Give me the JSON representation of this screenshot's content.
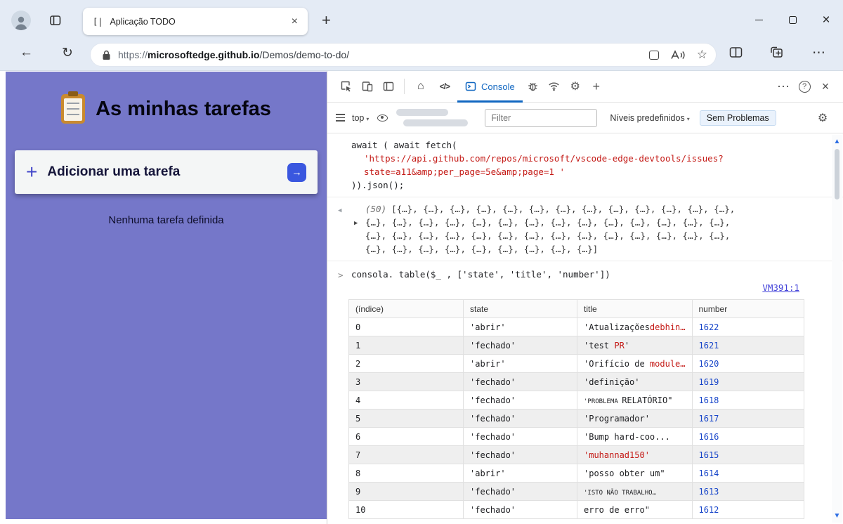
{
  "window": {
    "tab_title": "Aplicação TODO",
    "favicon_glyph": "[|",
    "url_scheme": "https://",
    "url_domain": "microsoftedge.github.io",
    "url_path": "/Demos/demo-to-do/"
  },
  "todo": {
    "title": "As minhas tarefas",
    "add_task": "Adicionar uma tarefa",
    "empty": "Nenhuma tarefa definida"
  },
  "devtools": {
    "console_tab": "Console",
    "context_label": "top",
    "filter_placeholder": "Filter",
    "levels_label": "Níveis predefinidos",
    "issues_label": "Sem Problemas",
    "cmd1_line1": "await ( await fetch(",
    "cmd1_line2": "'https://api.github.com/repos/microsoft/vscode-edge-devtools/issues?",
    "cmd1_line3": "state=a11&amp;per_page=5e&amp;page=1 '",
    "cmd1_line4": ")).json();",
    "result_count": "(50)",
    "result_line1": "[{…}, {…}, {…}, {…}, {…}, {…}, {…}, {…}, {…}, {…}, {…}, {…}, {…},",
    "result_line2": "{…}, {…}, {…}, {…}, {…}, {…}, {…}, {…}, {…}, {…}, {…}, {…}, {…}, {…},",
    "result_line3": "{…}, {…}, {…}, {…}, {…}, {…}, {…}, {…}, {…}, {…}, {…}, {…}, {…}, {…},",
    "result_line4": "{…}, {…}, {…}, {…}, {…}, {…}, {…}, {…}, {…}]",
    "cmd2": "consola. table($_  , ['state', 'title', 'number'])",
    "source_link": "VM391:1"
  },
  "table": {
    "headers": [
      "(índice)",
      "state",
      "title",
      "number"
    ],
    "rows": [
      {
        "index": "0",
        "state": "'abrir'",
        "title": [
          {
            "text": "'Atualizações",
            "style": "plain"
          },
          {
            "text": "debhin…",
            "style": "red"
          }
        ],
        "number": "1622"
      },
      {
        "index": "1",
        "state": "'fechado'",
        "title": [
          {
            "text": "'test   ",
            "style": "plain"
          },
          {
            "text": "PR",
            "style": "red"
          },
          {
            "text": "'",
            "style": "plain"
          }
        ],
        "number": "1621"
      },
      {
        "index": "2",
        "state": "'abrir'",
        "title": [
          {
            "text": "'Orifício de ",
            "style": "plain"
          },
          {
            "text": "module…",
            "style": "red"
          }
        ],
        "number": "1620"
      },
      {
        "index": "3",
        "state": "'fechado'",
        "title": [
          {
            "text": "'definição'",
            "style": "plain"
          }
        ],
        "number": "1619"
      },
      {
        "index": "4",
        "state": "'fechado'",
        "title": [
          {
            "text": "'PROBLEMA ",
            "style": "small"
          },
          {
            "text": "RELATÓRIO\"",
            "style": "plain"
          }
        ],
        "number": "1618"
      },
      {
        "index": "5",
        "state": "'fechado'",
        "title": [
          {
            "text": "'Programador'",
            "style": "plain"
          }
        ],
        "number": "1617"
      },
      {
        "index": "6",
        "state": "'fechado'",
        "title": [
          {
            "text": "'Bump hard-coo...",
            "style": "plain"
          }
        ],
        "number": "1616"
      },
      {
        "index": "7",
        "state": "'fechado'",
        "title": [
          {
            "text": "'muhannad150'",
            "style": "red"
          }
        ],
        "number": "1615"
      },
      {
        "index": "8",
        "state": "'abrir'",
        "title": [
          {
            "text": "'posso obter um\"",
            "style": "plain"
          }
        ],
        "number": "1614"
      },
      {
        "index": "9",
        "state": "'fechado'",
        "title": [
          {
            "text": "'ISTO NÃO TRABALHO…",
            "style": "small"
          }
        ],
        "number": "1613"
      },
      {
        "index": "10",
        "state": "'fechado'",
        "title": [
          {
            "text": "erro de erro\"",
            "style": "plain"
          }
        ],
        "number": "1612"
      }
    ]
  },
  "icons": {
    "back": "←",
    "refresh": "↻",
    "new_tab": "+",
    "close": "×",
    "star": "☆",
    "more": "⋯",
    "home": "⌂",
    "sources": "</>",
    "gear": "⚙",
    "plus": "+",
    "help": "?",
    "caret_down": "▾",
    "prompt": ">",
    "return_marker": "◀",
    "expand": "▶",
    "scroll_up": "▲",
    "scroll_down": "▼",
    "arrow_right": "→"
  },
  "colors": {
    "app_background": "#7577C9",
    "accent_blue": "#1167c1",
    "string_red": "#C41A16",
    "number_blue": "#1745C9",
    "link_blue": "#4343d9",
    "scroll_arrow_blue": "#2F6FE4",
    "add_button_blue": "#3A57DF"
  }
}
